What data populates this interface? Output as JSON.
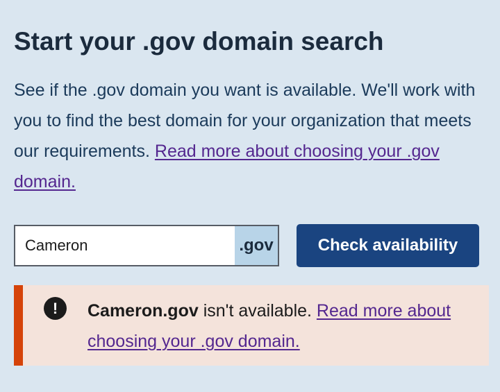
{
  "page": {
    "title": "Start your .gov domain search",
    "intro_text": "See if the .gov domain you want is available. We'll work with you to find the best domain for your organization that meets our requirements.",
    "intro_link": "Read more about choosing your .gov domain."
  },
  "search": {
    "input_value": "Cameron",
    "suffix": ".gov",
    "button_label": "Check availability"
  },
  "alert": {
    "icon": "exclamation-circle-icon",
    "domain": "Cameron.gov",
    "message": "isn't available.",
    "link": "Read more about choosing your .gov domain.",
    "accent_color": "#d54309"
  },
  "colors": {
    "background": "#dae6f0",
    "button": "#1a4480",
    "link": "#54278f",
    "alert_background": "#f4e3db"
  }
}
